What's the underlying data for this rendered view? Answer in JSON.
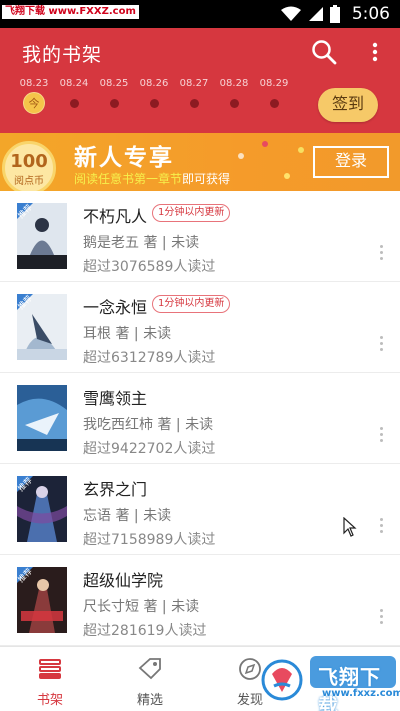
{
  "status_bar": {
    "watermark": "飞翔下载 www.FXXZ.com",
    "time": "5:06"
  },
  "header": {
    "title": "我的书架",
    "dates": [
      {
        "label": "08.23",
        "today_mark": "今"
      },
      {
        "label": "08.24"
      },
      {
        "label": "08.25"
      },
      {
        "label": "08.26"
      },
      {
        "label": "08.27"
      },
      {
        "label": "08.28"
      },
      {
        "label": "08.29"
      }
    ],
    "signin_label": "签到"
  },
  "promo": {
    "coin_value": "100",
    "coin_unit": "阅点币",
    "title": "新人专享",
    "subtitle_highlight": "阅读任意书第一章节",
    "subtitle_rest": "即可获得",
    "login_label": "登录"
  },
  "books": [
    {
      "title": "不朽凡人",
      "badge": "1分钟以内更新",
      "meta": "鹅是老五 著 | 未读",
      "readers": "超过3076589人读过",
      "tag": "推荐"
    },
    {
      "title": "一念永恒",
      "badge": "1分钟以内更新",
      "meta": "耳根 著 | 未读",
      "readers": "超过6312789人读过",
      "tag": "推荐"
    },
    {
      "title": "雪鹰领主",
      "badge": "",
      "meta": "我吃西红柿 著 | 未读",
      "readers": "超过9422702人读过",
      "tag": ""
    },
    {
      "title": "玄界之门",
      "badge": "",
      "meta": "忘语 著 | 未读",
      "readers": "超过7158989人读过",
      "tag": "推荐"
    },
    {
      "title": "超级仙学院",
      "badge": "",
      "meta": "尺长寸短 著 | 未读",
      "readers": "超过281619人读过",
      "tag": "推荐"
    }
  ],
  "bottom_nav": [
    {
      "label": "书架",
      "icon": "bookshelf-icon",
      "active": true
    },
    {
      "label": "精选",
      "icon": "tag-icon",
      "active": false
    },
    {
      "label": "发现",
      "icon": "compass-icon",
      "active": false
    }
  ],
  "watermark_logo": {
    "text": "飞翔下载",
    "url": "www.fxxz.com"
  },
  "colors": {
    "header": "#d6373f",
    "accent": "#d6373f",
    "promo": "#f3a629",
    "signin": "#f6c968"
  }
}
